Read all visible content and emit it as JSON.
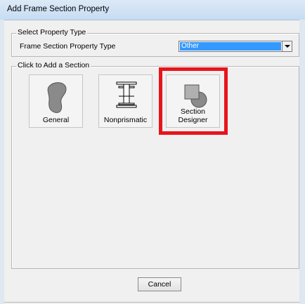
{
  "window": {
    "title": "Add Frame Section Property"
  },
  "select_property": {
    "group_label": "Select Property Type",
    "field_label": "Frame Section Property Type",
    "selected_value": "Other"
  },
  "add_section": {
    "group_label": "Click to Add a Section",
    "tiles": [
      {
        "label": "General",
        "icon": "general-section-icon"
      },
      {
        "label": "Nonprismatic",
        "icon": "i-beam-icon"
      },
      {
        "label": "Section Designer",
        "icon": "section-designer-icon"
      }
    ]
  },
  "buttons": {
    "cancel": "Cancel"
  },
  "colors": {
    "highlight": "#e8141b",
    "selection": "#3399ff"
  }
}
